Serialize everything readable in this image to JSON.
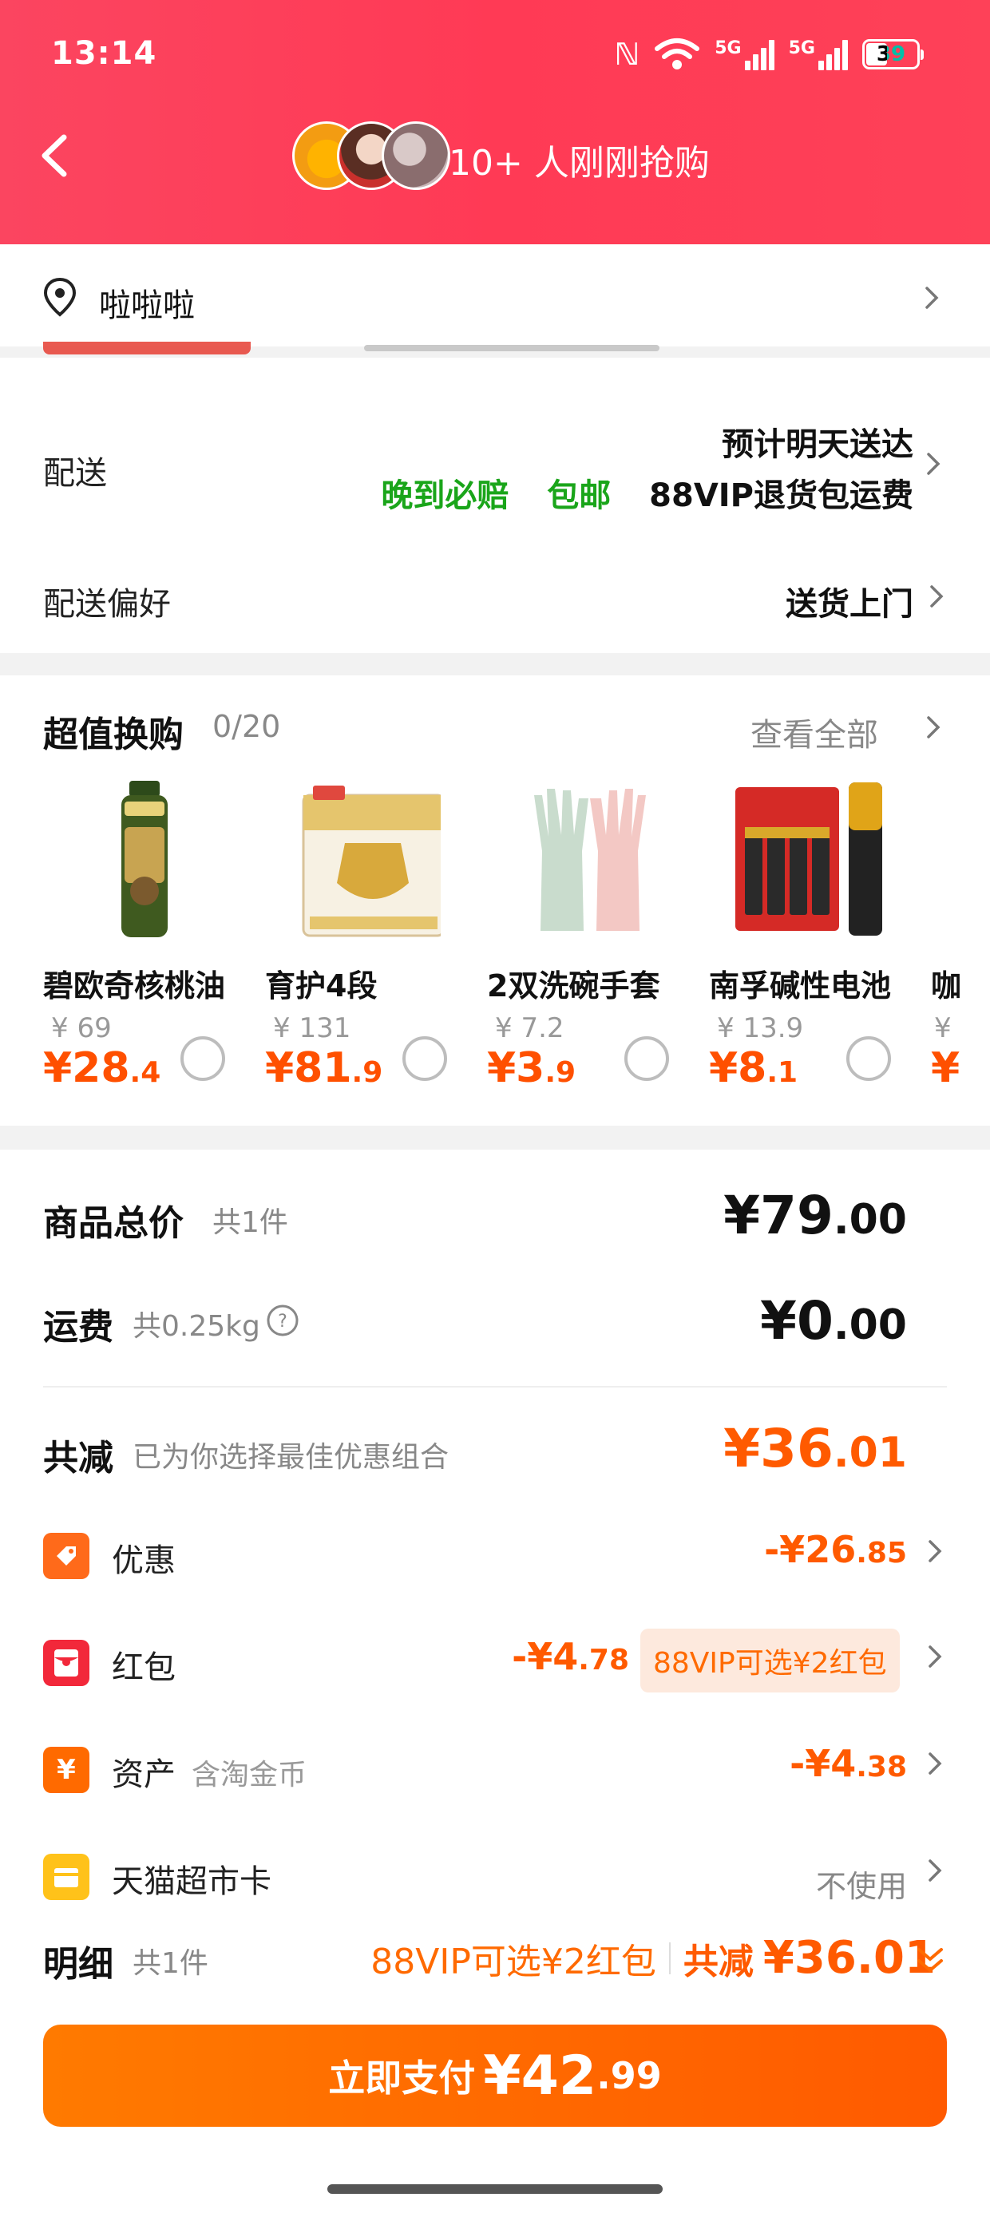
{
  "status": {
    "time": "13:14",
    "battery": "39",
    "net1": "5G",
    "net2": "5G"
  },
  "header": {
    "buying_text": "10+ 人刚刚抢购"
  },
  "address": {
    "text": "啦啦啦"
  },
  "delivery": {
    "label": "配送",
    "eta": "预计明天送达",
    "tag_late": "晚到必赔",
    "tag_free": "包邮",
    "tag_vip": "88VIP退货包运费",
    "pref_label": "配送偏好",
    "pref_value": "送货上门"
  },
  "swap": {
    "title": "超值换购",
    "count": "0/20",
    "view_all": "查看全部",
    "products": [
      {
        "name": "碧欧奇核桃油",
        "old_price": "¥ 69",
        "new_int": "¥28",
        "new_dec": ".4"
      },
      {
        "name": "育护4段",
        "old_price": "¥ 131",
        "new_int": "¥81",
        "new_dec": ".9"
      },
      {
        "name": "2双洗碗手套",
        "old_price": "¥ 7.2",
        "new_int": "¥3",
        "new_dec": ".9"
      },
      {
        "name": "南孚碱性电池",
        "old_price": "¥ 13.9",
        "new_int": "¥8",
        "new_dec": ".1"
      },
      {
        "name": "咖",
        "old_price": "¥",
        "new_int": "¥",
        "new_dec": ""
      }
    ]
  },
  "totals": {
    "goods_label": "商品总价",
    "goods_count": "共1件",
    "goods_int": "¥79",
    "goods_dec": ".00",
    "ship_label": "运费",
    "ship_weight": "共0.25kg",
    "ship_int": "¥0",
    "ship_dec": ".00",
    "reduce_label": "共减",
    "reduce_note": "已为你选择最佳优惠组合",
    "reduce_int": "¥36",
    "reduce_dec": ".01"
  },
  "discounts": {
    "coupon_label": "优惠",
    "coupon_int": "-¥26",
    "coupon_dec": ".85",
    "redpack_label": "红包",
    "redpack_int": "-¥4",
    "redpack_dec": ".78",
    "redpack_vip": "88VIP可选¥2红包",
    "asset_label": "资产",
    "asset_sub": "含淘金币",
    "asset_int": "-¥4",
    "asset_dec": ".38",
    "card_label": "天猫超市卡",
    "card_value": "不使用"
  },
  "detail": {
    "label": "明细",
    "count": "共1件",
    "vip": "88VIP可选¥2红包",
    "total_label": "共减",
    "total_value": "¥36.01"
  },
  "pay": {
    "label": "立即支付",
    "int": "¥42",
    "dec": ".99"
  },
  "colors": {
    "header": "#fe3f57",
    "accent": "#ff5a00",
    "green": "#1aa51a"
  }
}
